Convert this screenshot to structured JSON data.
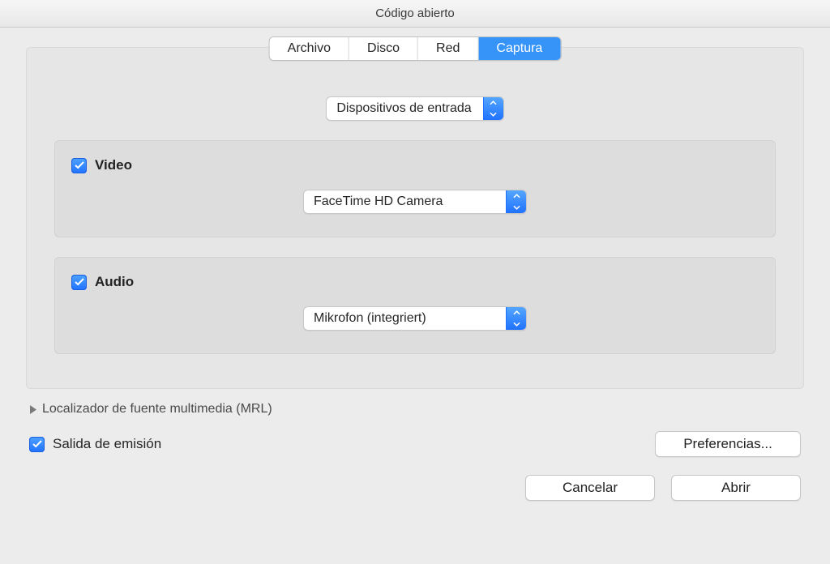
{
  "window": {
    "title": "Código abierto"
  },
  "tabs": [
    {
      "label": "Archivo",
      "active": false
    },
    {
      "label": "Disco",
      "active": false
    },
    {
      "label": "Red",
      "active": false
    },
    {
      "label": "Captura",
      "active": true
    }
  ],
  "input_devices_select": "Dispositivos de entrada",
  "video": {
    "label": "Video",
    "checked": true,
    "device": "FaceTime HD Camera"
  },
  "audio": {
    "label": "Audio",
    "checked": true,
    "device": "Mikrofon (integriert)"
  },
  "mrl_disclosure": "Localizador de fuente multimedia (MRL)",
  "stream_output": {
    "label": "Salida de emisión",
    "checked": true
  },
  "buttons": {
    "preferences": "Preferencias...",
    "cancel": "Cancelar",
    "open": "Abrir"
  }
}
